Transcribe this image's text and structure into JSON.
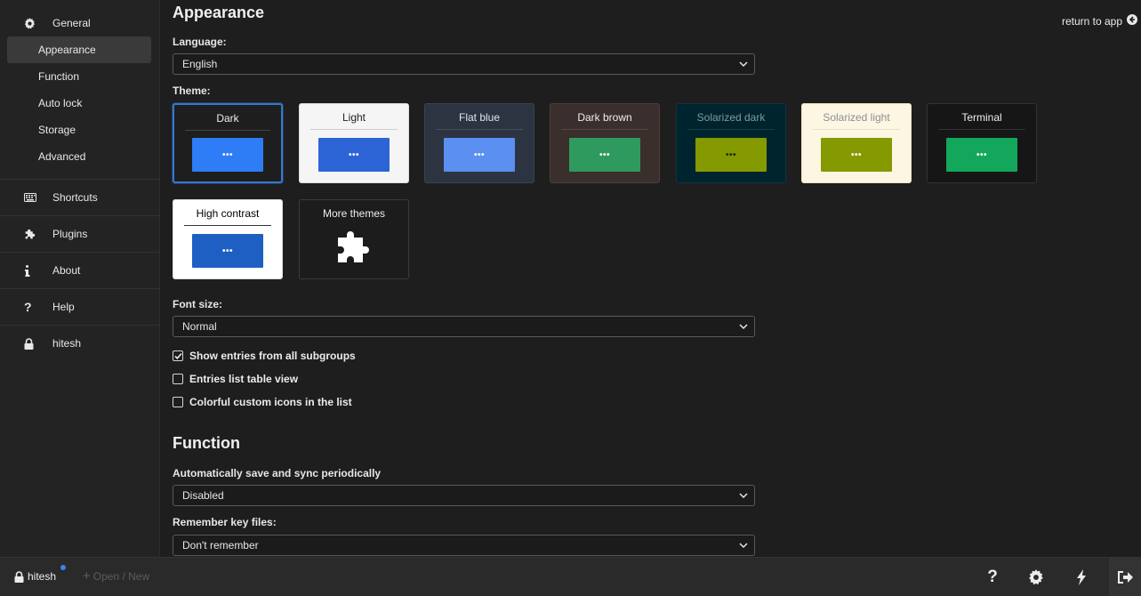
{
  "sidebar": {
    "general": "General",
    "sub": [
      "Appearance",
      "Function",
      "Auto lock",
      "Storage",
      "Advanced"
    ],
    "shortcuts": "Shortcuts",
    "plugins": "Plugins",
    "about": "About",
    "help": "Help",
    "user": "hitesh"
  },
  "header": {
    "return_label": "return to app"
  },
  "appearance": {
    "title": "Appearance",
    "language_label": "Language:",
    "language_value": "English",
    "theme_label": "Theme:",
    "themes": [
      {
        "name": "Dark",
        "button": "•••"
      },
      {
        "name": "Light",
        "button": "•••"
      },
      {
        "name": "Flat blue",
        "button": "•••"
      },
      {
        "name": "Dark brown",
        "button": "•••"
      },
      {
        "name": "Solarized dark",
        "button": "•••"
      },
      {
        "name": "Solarized light",
        "button": "•••"
      },
      {
        "name": "Terminal",
        "button": "•••"
      },
      {
        "name": "High contrast",
        "button": "•••"
      },
      {
        "name": "More themes"
      }
    ],
    "font_size_label": "Font size:",
    "font_size_value": "Normal",
    "checkboxes": [
      {
        "label": "Show entries from all subgroups",
        "checked": true
      },
      {
        "label": "Entries list table view",
        "checked": false
      },
      {
        "label": "Colorful custom icons in the list",
        "checked": false
      }
    ]
  },
  "function": {
    "title": "Function",
    "autosave_label": "Automatically save and sync periodically",
    "autosave_value": "Disabled",
    "keyfiles_label": "Remember key files:",
    "keyfiles_value": "Don't remember"
  },
  "footer": {
    "user": "hitesh",
    "open_new": "Open / New"
  },
  "colors": {
    "accent": "#3a78c4",
    "notification_dot": "#3b82f6"
  }
}
